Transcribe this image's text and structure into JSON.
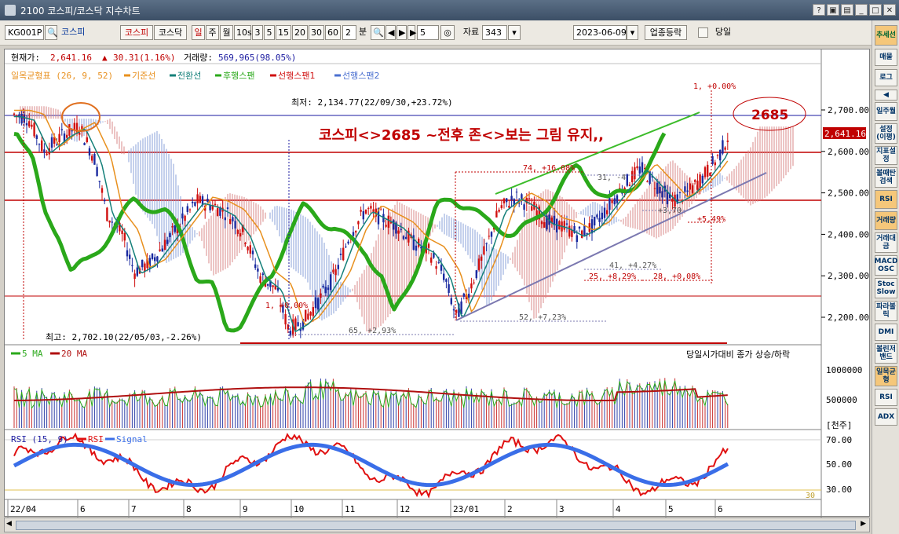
{
  "window": {
    "title": "2100 코스피/코스닥 지수차트"
  },
  "toolbar": {
    "code": "KG001P",
    "name": "코스피",
    "btn_kospi": "코스피",
    "btn_kosdaq": "코스닥",
    "periods": [
      "일",
      "주",
      "월",
      "10s",
      "3",
      "5",
      "15",
      "20",
      "30",
      "60"
    ],
    "minute_value": "2",
    "minute_unit": "분",
    "step_value": "5",
    "data_label": "자료",
    "data_count": "343",
    "date": "2023-06-09",
    "sector_button": "업종등락",
    "today_label": "당일"
  },
  "sidebar": {
    "items": [
      "추세선",
      "매물",
      "로그",
      "◀",
      "일주월",
      "설정(이평)",
      "지표설정",
      "볼때탄검색",
      "RSI",
      "거래량",
      "거래대금",
      "MACD OSC",
      "Stoc Slow",
      "파라볼릭",
      "DMI",
      "볼린저밴드",
      "일목균형",
      "RSI",
      "ADX"
    ]
  },
  "info": {
    "current_label": "현재가:",
    "current_value": "2,641.16",
    "change": "30.31(1.16%)",
    "volume_label": "거래량:",
    "volume_value": "569,965(98.05%)"
  },
  "legend": {
    "title": "일목균형표 (26, 9, 52)",
    "items": [
      {
        "label": "기준선",
        "color": "#e8901e"
      },
      {
        "label": "전환선",
        "color": "#15807a"
      },
      {
        "label": "후행스팬",
        "color": "#2aa81a"
      },
      {
        "label": "선행스팬1",
        "color": "#d01010"
      },
      {
        "label": "선행스팬2",
        "color": "#4a6fd0"
      }
    ]
  },
  "annotations": {
    "low": "최저: 2,134.77(22/09/30,+23.72%)",
    "high": "최고: 2,702.10(22/05/03,-2.26%)",
    "main_text": "코스피<>2685 ~전후 존<>보는 그림 유지,,",
    "target": "2685",
    "one_pct": "1, +0.00%",
    "m74": "74, +16.08%",
    "m65": "65, +2,93%",
    "m52": "52, +7,23%",
    "m41": "41, +4.27%",
    "m25": "25, +8,29%",
    "m28": "28, +0,08%",
    "m31": "31, -4",
    "m37": "+3,70",
    "m549": "+5,49%",
    "m1": "1, +0,00%"
  },
  "price_axis": {
    "ticks": [
      "2,700.00",
      "2,600.00",
      "2,500.00",
      "2,400.00",
      "2,300.00",
      "2,200.00"
    ],
    "current": "2,641.16"
  },
  "volume_panel": {
    "ma5": "5 MA",
    "ma20": "20 MA",
    "note": "당일시가대비 종가 상승/하락",
    "ticks": [
      "1000000",
      "500000"
    ],
    "unit": "[천주]"
  },
  "rsi_panel": {
    "label": "RSI (15, 9)",
    "rsi": "RSI",
    "signal": "Signal",
    "ticks": [
      "70.00",
      "50.00",
      "30.00"
    ],
    "level": "30"
  },
  "x_axis": {
    "labels": [
      "22/04",
      "6",
      "7",
      "8",
      "9",
      "10",
      "11",
      "12",
      "23/01",
      "2",
      "3",
      "4",
      "5",
      "6"
    ]
  },
  "colors": {
    "up": "#d01010",
    "down": "#1a2aa0",
    "green": "#2aa81a",
    "accent": "#c00000"
  }
}
